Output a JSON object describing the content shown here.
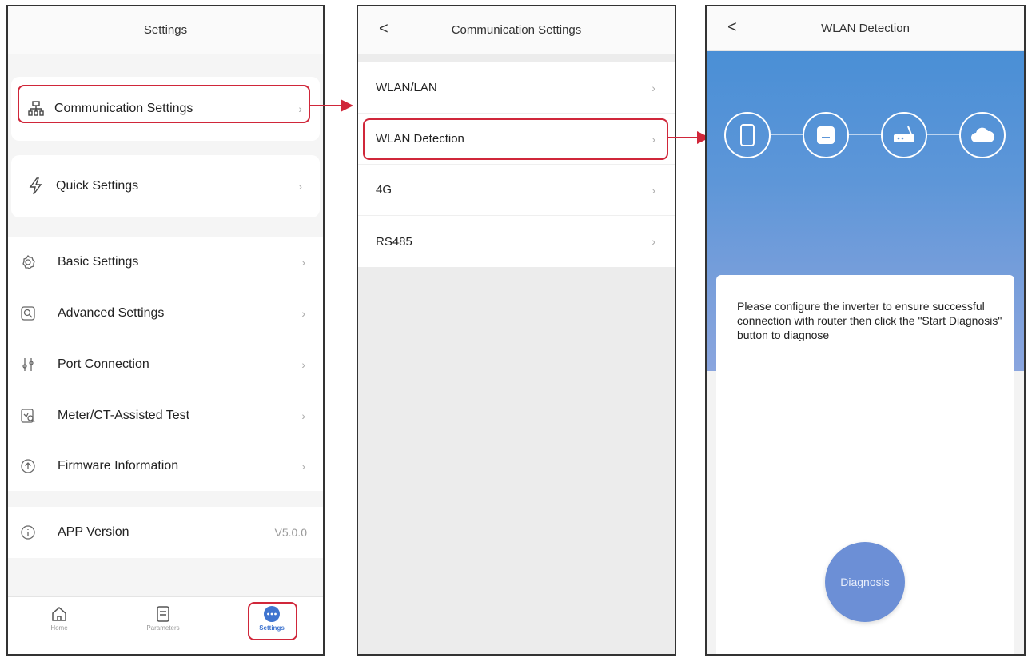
{
  "screen1": {
    "title": "Settings",
    "card_items": [
      {
        "label": "Communication Settings",
        "icon": "network-icon"
      },
      {
        "label": "Quick Settings",
        "icon": "lightning-icon"
      }
    ],
    "menu_items": [
      {
        "label": "Basic Settings",
        "icon": "gear-icon"
      },
      {
        "label": "Advanced Settings",
        "icon": "search-gear-icon"
      },
      {
        "label": "Port Connection",
        "icon": "port-icon"
      },
      {
        "label": "Meter/CT-Assisted Test",
        "icon": "meter-test-icon"
      },
      {
        "label": "Firmware Information",
        "icon": "upload-icon"
      }
    ],
    "app_version": {
      "label": "APP Version",
      "value": "V5.0.0",
      "icon": "info-icon"
    },
    "tabs": [
      {
        "label": "Home",
        "icon": "home-icon"
      },
      {
        "label": "Parameters",
        "icon": "document-icon"
      },
      {
        "label": "Settings",
        "icon": "more-icon"
      }
    ]
  },
  "screen2": {
    "back": "<",
    "title": "Communication Settings",
    "items": [
      "WLAN/LAN",
      "WLAN Detection",
      "4G",
      "RS485"
    ]
  },
  "screen3": {
    "back": "<",
    "title": "WLAN Detection",
    "steps": [
      "phone-icon",
      "inverter-icon",
      "router-icon",
      "cloud-icon"
    ],
    "message": "Please configure the inverter to ensure successful connection with router then click the \"Start Diagnosis\" button to diagnose",
    "button": "Diagnosis"
  },
  "colors": {
    "highlight": "#d0273a",
    "accent": "#3f74cf",
    "hero_top": "#4a8fd6",
    "hero_bottom": "#8aa5de"
  },
  "chevron": "›"
}
